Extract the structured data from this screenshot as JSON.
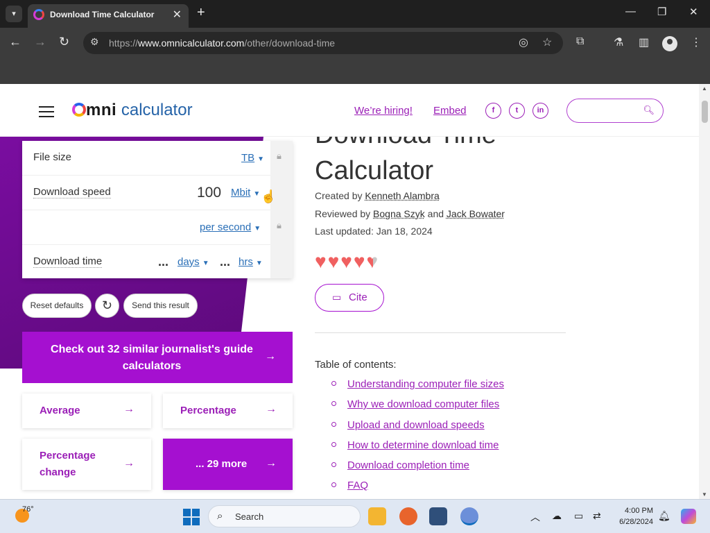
{
  "browser": {
    "tab_title": "Download Time Calculator",
    "url_domain": "www.omnicalculator.com",
    "url_path": "/other/download-time",
    "url_scheme": "https://"
  },
  "header": {
    "logo_omni": "mni",
    "logo_calc": "calculator",
    "hiring_link": "We’re hiring!",
    "embed_link": "Embed",
    "social": [
      "f",
      "t",
      "in"
    ]
  },
  "calculator": {
    "file_size_label": "File size",
    "file_size_unit": "TB",
    "download_speed_label": "Download speed",
    "download_speed_value": "100",
    "download_speed_unit": "Mbit",
    "per_unit": "per second",
    "download_time_label": "Download time",
    "download_time_dots1": "...",
    "download_time_unit1": "days",
    "download_time_dots2": "...",
    "download_time_unit2": "hrs",
    "reset_label": "Reset defaults",
    "send_label": "Send this result"
  },
  "related": {
    "banner": "Check out 32 similar journalist's guide calculators",
    "cards": [
      "Average",
      "Percentage",
      "Percentage change",
      "... 29 more"
    ]
  },
  "article": {
    "title_line1": "Download Time",
    "title_line2": "Calculator",
    "created_by_prefix": "Created by",
    "created_by": "Kenneth Alambra",
    "reviewed_by_prefix": "Reviewed by",
    "reviewer1": "Bogna Szyk",
    "and_text": "and",
    "reviewer2": "Jack Bowater",
    "last_updated": "Last updated: Jan 18, 2024",
    "rating_stars": 4.5,
    "cite_label": "Cite",
    "toc_title": "Table of contents:",
    "toc": [
      "Understanding computer file sizes",
      "Why we download computer files",
      "Upload and download speeds",
      "How to determine download time",
      "Download completion time",
      "FAQ"
    ]
  },
  "taskbar": {
    "temperature": "76°",
    "search_placeholder": "Search",
    "time": "4:00 PM",
    "date": "6/28/2024"
  },
  "colors": {
    "accent": "#a510d0",
    "link_blue": "#2a6fb7"
  },
  "icons": [
    "tab-search-icon",
    "back-icon",
    "forward-icon",
    "reload-icon",
    "site-info-icon",
    "eye-off-icon",
    "star-icon",
    "extensions-icon",
    "labs-icon",
    "sidepanel-icon",
    "profile-icon",
    "menu-icon",
    "search-icon",
    "lock-icon",
    "refresh-icon",
    "arrow-right-icon",
    "cite-icon"
  ]
}
